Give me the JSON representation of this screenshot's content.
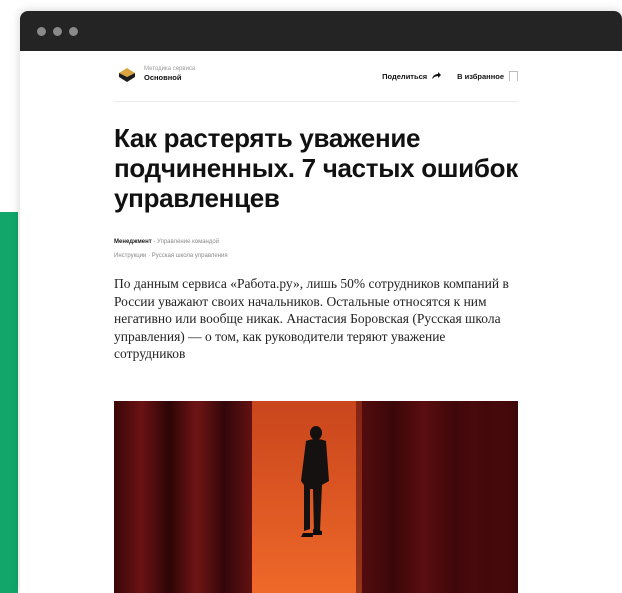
{
  "window": {
    "dots": [
      "red",
      "yellow",
      "green"
    ]
  },
  "header": {
    "logo_subtitle": "Методика сервиса",
    "logo_name": "Основной",
    "share_label": "Поделиться",
    "favorites_label": "В избранное"
  },
  "article": {
    "title": "Как растерять уважение подчиненных. 7 частых ошибок управленцев",
    "tag_category": "Менеджмент",
    "tag_topic": "Управление командой",
    "tag_type": "Инструкции",
    "tag_source": "Русская школа управления",
    "lead": "По данным сервиса «Работа.ру», лишь 50% сотрудников компаний в России уважают своих начальников. Остальные относятся к ним негативно или вообще никак. Анастасия Боровская (Русская школа управления) — о том, как руководители теряют уважение сотрудников"
  },
  "colors": {
    "accent_green": "#12a66a",
    "titlebar": "#242424",
    "curtain": "#5a0d0e",
    "runway": "#e25a24"
  },
  "icons": [
    "logo-icon",
    "share-arrow-icon",
    "bookmark-icon"
  ]
}
